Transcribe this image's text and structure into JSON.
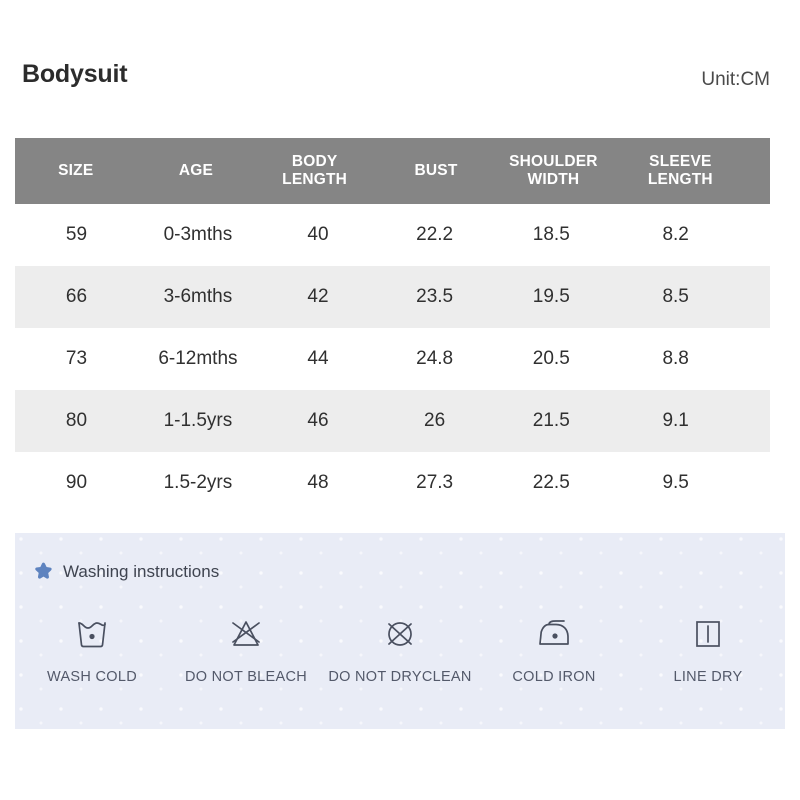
{
  "header": {
    "product_title": "Bodysuit",
    "unit_label": "Unit:CM"
  },
  "table": {
    "columns": [
      {
        "line1": "SIZE",
        "line2": ""
      },
      {
        "line1": "AGE",
        "line2": ""
      },
      {
        "line1": "BODY",
        "line2": "LENGTH"
      },
      {
        "line1": "BUST",
        "line2": ""
      },
      {
        "line1": "SHOULDER",
        "line2": "WIDTH"
      },
      {
        "line1": "SLEEVE",
        "line2": "LENGTH"
      }
    ],
    "header_bg": "#858585",
    "header_text_color": "#ffffff",
    "alt_row_bg": "#ededed",
    "rows": [
      {
        "size": "59",
        "age": "0-3mths",
        "body_length": "40",
        "bust": "22.2",
        "shoulder_width": "18.5",
        "sleeve_length": "8.2"
      },
      {
        "size": "66",
        "age": "3-6mths",
        "body_length": "42",
        "bust": "23.5",
        "shoulder_width": "19.5",
        "sleeve_length": "8.5"
      },
      {
        "size": "73",
        "age": "6-12mths",
        "body_length": "44",
        "bust": "24.8",
        "shoulder_width": "20.5",
        "sleeve_length": "8.8"
      },
      {
        "size": "80",
        "age": "1-1.5yrs",
        "body_length": "46",
        "bust": "26",
        "shoulder_width": "21.5",
        "sleeve_length": "9.1"
      },
      {
        "size": "90",
        "age": "1.5-2yrs",
        "body_length": "48",
        "bust": "27.3",
        "shoulder_width": "22.5",
        "sleeve_length": "9.5"
      }
    ]
  },
  "washing": {
    "heading": "Washing instructions",
    "star_color": "#5e83bf",
    "panel_bg": "#e9ecf6",
    "icon_color": "#4a5060",
    "items": [
      {
        "icon": "wash-tub-icon",
        "label": "WASH COLD"
      },
      {
        "icon": "no-bleach-icon",
        "label": "DO NOT BLEACH"
      },
      {
        "icon": "no-dryclean-icon",
        "label": "DO NOT DRYCLEAN"
      },
      {
        "icon": "cold-iron-icon",
        "label": "COLD IRON"
      },
      {
        "icon": "line-dry-icon",
        "label": "LINE DRY"
      }
    ]
  }
}
